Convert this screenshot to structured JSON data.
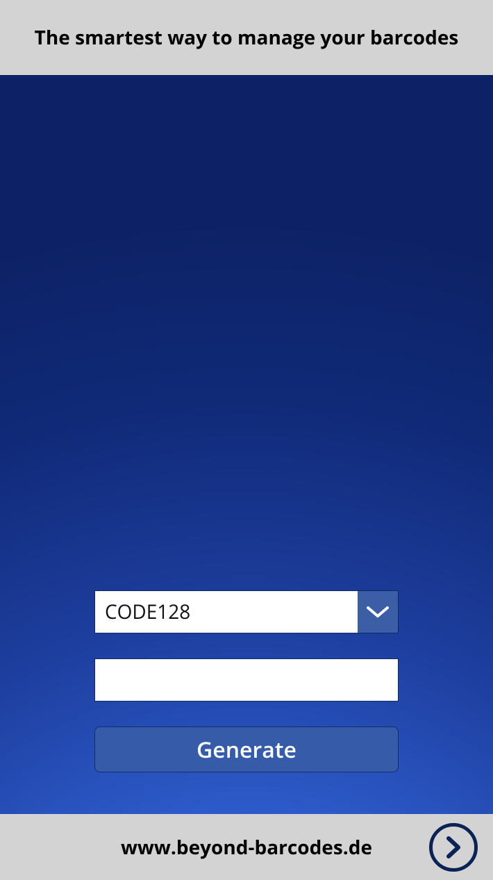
{
  "header": {
    "title": "The smartest way to manage your barcodes"
  },
  "form": {
    "barcode_type": "CODE128",
    "input_value": "",
    "generate_label": "Generate"
  },
  "footer": {
    "link_text": "www.beyond-barcodes.de"
  }
}
